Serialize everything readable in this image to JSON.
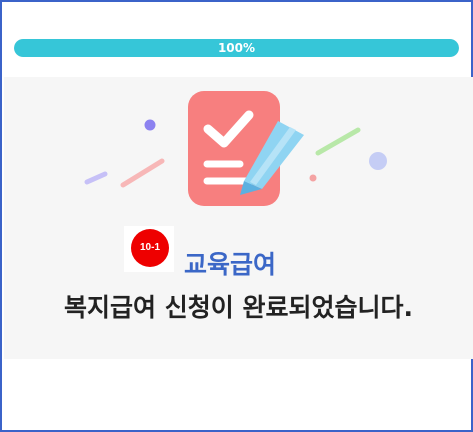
{
  "progress": {
    "value": 100,
    "label": "100%"
  },
  "badge": {
    "label": "10-1"
  },
  "benefit_title": "교육급여",
  "message": "복지급여 신청이 완료되었습니다.",
  "icons": {
    "illustration": "checklist-pencil-icon",
    "decor": "confetti-decoration"
  },
  "colors": {
    "accent": "#36c6d8",
    "title": "#3b67c7",
    "badge": "#ee0000",
    "frame": "#3b63c9"
  }
}
